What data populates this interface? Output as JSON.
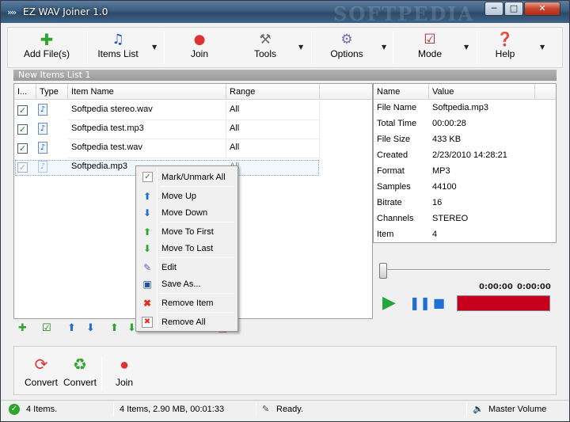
{
  "window": {
    "title": "EZ WAV Joiner 1.0",
    "watermark": "SOFTPEDIA",
    "min": "─",
    "max": "□",
    "close": "✕"
  },
  "toolbar": {
    "add_files": "Add File(s)",
    "items_list": "Items List",
    "join": "Join",
    "tools": "Tools",
    "options": "Options",
    "mode": "Mode",
    "help": "Help",
    "arrow": "▼"
  },
  "list": {
    "header": "New Items List 1",
    "columns": [
      "I...",
      "Type",
      "Item Name",
      "Range"
    ],
    "rows": [
      {
        "name": "Softpedia stereo.wav",
        "range": "All"
      },
      {
        "name": "Softpedia test.mp3",
        "range": "All"
      },
      {
        "name": "Softpedia test.wav",
        "range": "All"
      },
      {
        "name": "Softpedia.mp3",
        "range": "All"
      }
    ]
  },
  "props": {
    "columns": [
      "Name",
      "Value"
    ],
    "rows": [
      {
        "name": "File Name",
        "value": "Softpedia.mp3"
      },
      {
        "name": "Total Time",
        "value": "00:00:28"
      },
      {
        "name": "File Size",
        "value": "433 KB"
      },
      {
        "name": "Created",
        "value": "2/23/2010 14:28:21"
      },
      {
        "name": "Format",
        "value": "MP3"
      },
      {
        "name": "Samples",
        "value": "44100"
      },
      {
        "name": "Bitrate",
        "value": "16"
      },
      {
        "name": "Channels",
        "value": "STEREO"
      },
      {
        "name": "Item",
        "value": "4"
      }
    ]
  },
  "player": {
    "time_current": "0:00:00",
    "time_total": "0:00:00"
  },
  "context_menu": {
    "items": [
      "Mark/Unmark All",
      "Move Up",
      "Move Down",
      "Move To First",
      "Move To Last",
      "Edit",
      "Save As...",
      "Remove Item",
      "Remove All"
    ]
  },
  "convert": {
    "convert1": "Convert",
    "convert2": "Convert",
    "join": "Join"
  },
  "status": {
    "items": "4 Items.",
    "summary": "4 Items, 2.90 MB, 00:01:33",
    "state": "Ready.",
    "volume": "Master Volume"
  },
  "colors": {
    "level_bar": "#c8001e",
    "title_bar": "#3c5d7e"
  }
}
